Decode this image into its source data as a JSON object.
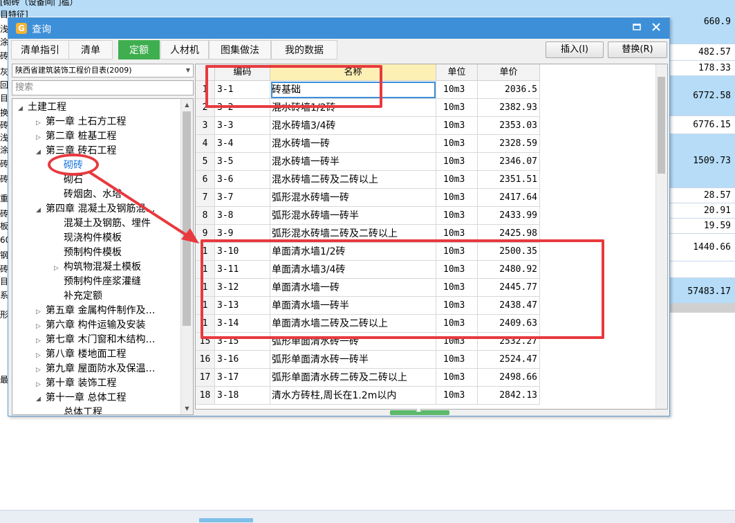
{
  "background": {
    "top_text": "[砌砖（设备间门槛）",
    "left_fragments": [
      "目特征]",
      "浅",
      "涂",
      "砖",
      "灰",
      "回",
      "目",
      "换",
      "砖",
      "浅",
      "涂",
      "砖",
      "砖",
      "重",
      "砖",
      "板",
      "60",
      "钢",
      "砖",
      "目",
      "系",
      "形",
      "最"
    ],
    "right_values": [
      {
        "value": "660.9",
        "hl": true
      },
      {
        "value": "482.57",
        "hl": false
      },
      {
        "value": "178.33",
        "hl": false
      },
      {
        "value": "6772.58",
        "hl": true
      },
      {
        "value": "6776.15",
        "hl": false
      },
      {
        "value": "1509.73",
        "hl": true
      },
      {
        "value": "28.57",
        "hl": false
      },
      {
        "value": "20.91",
        "hl": false
      },
      {
        "value": "19.59",
        "hl": false
      },
      {
        "value": "1440.66",
        "hl": false
      },
      {
        "value": "",
        "hl": false
      },
      {
        "value": "57483.17",
        "hl": true
      }
    ]
  },
  "dialog": {
    "title": "查询",
    "icon": "app-icon",
    "minimize_icon": "minimize-icon",
    "close_icon": "close-icon",
    "tabs": [
      {
        "label": "清单指引",
        "active": false
      },
      {
        "label": "清单",
        "active": false
      },
      {
        "label": "定额",
        "active": true
      },
      {
        "label": "人材机",
        "active": false
      },
      {
        "label": "图集做法",
        "active": false
      },
      {
        "label": "我的数据",
        "active": false
      }
    ],
    "insert_button": "插入(I)",
    "replace_button": "替换(R)",
    "library_select": "陕西省建筑装饰工程价目表(2009)",
    "search_placeholder": "搜索",
    "tree": [
      {
        "label": "土建工程",
        "level": 0,
        "expander": "expanded"
      },
      {
        "label": "第一章 土石方工程",
        "level": 1,
        "expander": "collapsed"
      },
      {
        "label": "第二章 桩基工程",
        "level": 1,
        "expander": "collapsed"
      },
      {
        "label": "第三章 砖石工程",
        "level": 1,
        "expander": "expanded"
      },
      {
        "label": "砌砖",
        "level": 2,
        "expander": "none",
        "selected": true
      },
      {
        "label": "砌石",
        "level": 2,
        "expander": "none"
      },
      {
        "label": "砖烟囱、水塔",
        "level": 2,
        "expander": "none"
      },
      {
        "label": "第四章 混凝土及钢筋混…",
        "level": 1,
        "expander": "expanded"
      },
      {
        "label": "混凝土及钢筋、埋件",
        "level": 2,
        "expander": "none"
      },
      {
        "label": "现浇构件模板",
        "level": 2,
        "expander": "none"
      },
      {
        "label": "预制构件模板",
        "level": 2,
        "expander": "none"
      },
      {
        "label": "构筑物混凝土模板",
        "level": 2,
        "expander": "collapsed"
      },
      {
        "label": "预制构件座浆灌缝",
        "level": 2,
        "expander": "none"
      },
      {
        "label": "补充定额",
        "level": 2,
        "expander": "none"
      },
      {
        "label": "第五章 金属构件制作及…",
        "level": 1,
        "expander": "collapsed"
      },
      {
        "label": "第六章 构件运输及安装",
        "level": 1,
        "expander": "collapsed"
      },
      {
        "label": "第七章 木门窗和木结构…",
        "level": 1,
        "expander": "collapsed"
      },
      {
        "label": "第八章 楼地面工程",
        "level": 1,
        "expander": "collapsed"
      },
      {
        "label": "第九章 屋面防水及保温…",
        "level": 1,
        "expander": "collapsed"
      },
      {
        "label": "第十章 装饰工程",
        "level": 1,
        "expander": "collapsed"
      },
      {
        "label": "第十一章 总体工程",
        "level": 1,
        "expander": "expanded"
      },
      {
        "label": "总体工程",
        "level": 2,
        "expander": "none"
      }
    ],
    "grid": {
      "headers": {
        "code": "编码",
        "name": "名称",
        "unit": "单位",
        "price": "单价"
      },
      "rows": [
        {
          "idx": "1",
          "code": "3-1",
          "name": "砖基础",
          "unit": "10m3",
          "price": "2036.5"
        },
        {
          "idx": "2",
          "code": "3-2",
          "name": "混水砖墙1/2砖",
          "unit": "10m3",
          "price": "2382.93"
        },
        {
          "idx": "3",
          "code": "3-3",
          "name": "混水砖墙3/4砖",
          "unit": "10m3",
          "price": "2353.03"
        },
        {
          "idx": "4",
          "code": "3-4",
          "name": "混水砖墙一砖",
          "unit": "10m3",
          "price": "2328.59"
        },
        {
          "idx": "5",
          "code": "3-5",
          "name": "混水砖墙一砖半",
          "unit": "10m3",
          "price": "2346.07"
        },
        {
          "idx": "6",
          "code": "3-6",
          "name": "混水砖墙二砖及二砖以上",
          "unit": "10m3",
          "price": "2351.51"
        },
        {
          "idx": "7",
          "code": "3-7",
          "name": "弧形混水砖墙一砖",
          "unit": "10m3",
          "price": "2417.64"
        },
        {
          "idx": "8",
          "code": "3-8",
          "name": "弧形混水砖墙一砖半",
          "unit": "10m3",
          "price": "2433.99"
        },
        {
          "idx": "9",
          "code": "3-9",
          "name": "弧形混水砖墙二砖及二砖以上",
          "unit": "10m3",
          "price": "2425.98"
        },
        {
          "idx": "1",
          "code": "3-10",
          "name": "单面清水墙1/2砖",
          "unit": "10m3",
          "price": "2500.35"
        },
        {
          "idx": "1",
          "code": "3-11",
          "name": "单面清水墙3/4砖",
          "unit": "10m3",
          "price": "2480.92"
        },
        {
          "idx": "1",
          "code": "3-12",
          "name": "单面清水墙一砖",
          "unit": "10m3",
          "price": "2445.77"
        },
        {
          "idx": "1",
          "code": "3-13",
          "name": "单面清水墙一砖半",
          "unit": "10m3",
          "price": "2438.47"
        },
        {
          "idx": "1",
          "code": "3-14",
          "name": "单面清水墙二砖及二砖以上",
          "unit": "10m3",
          "price": "2409.63"
        },
        {
          "idx": "15",
          "code": "3-15",
          "name": "弧形单面清水砖一砖",
          "unit": "10m3",
          "price": "2532.27"
        },
        {
          "idx": "16",
          "code": "3-16",
          "name": "弧形单面清水砖一砖半",
          "unit": "10m3",
          "price": "2524.47"
        },
        {
          "idx": "17",
          "code": "3-17",
          "name": "弧形单面清水砖二砖及二砖以上",
          "unit": "10m3",
          "price": "2498.66"
        },
        {
          "idx": "18",
          "code": "3-18",
          "name": "清水方砖柱,周长在1.2m以内",
          "unit": "10m3",
          "price": "2842.13"
        }
      ]
    }
  },
  "colors": {
    "accent": "#3d8fd8",
    "tab_active": "#3fae4f",
    "annotation": "#e8393e",
    "highlight_bg": "#b6dcf7"
  }
}
